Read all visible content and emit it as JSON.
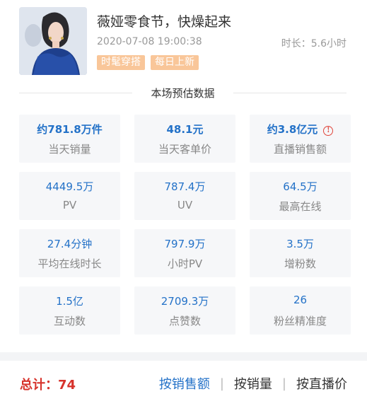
{
  "header": {
    "title": "薇娅零食节，快燥起来",
    "time": "2020-07-08 19:00:38",
    "duration_label": "时长：",
    "duration_value": "5.6小时",
    "tags": [
      "时髦穿搭",
      "每日上新"
    ]
  },
  "section_title": "本场预估数据",
  "stats": [
    {
      "value": "约781.8万件",
      "label": "当天销量",
      "bold": true
    },
    {
      "value": "48.1元",
      "label": "当天客单价",
      "bold": true
    },
    {
      "value": "约3.8亿元",
      "label": "直播销售额",
      "bold": true,
      "info_icon": "info-circle-icon"
    },
    {
      "value": "4449.5万",
      "label": "PV"
    },
    {
      "value": "787.4万",
      "label": "UV"
    },
    {
      "value": "64.5万",
      "label": "最高在线"
    },
    {
      "value": "27.4分钟",
      "label": "平均在线时长"
    },
    {
      "value": "797.9万",
      "label": "小时PV"
    },
    {
      "value": "3.5万",
      "label": "增粉数"
    },
    {
      "value": "1.5亿",
      "label": "互动数"
    },
    {
      "value": "2709.3万",
      "label": "点赞数"
    },
    {
      "value": "26",
      "label": "粉丝精准度"
    }
  ],
  "footer": {
    "total_label": "总计：",
    "total_value": "74",
    "sort_options": [
      "按销售额",
      "按销量",
      "按直播价"
    ],
    "active_sort": "按销售额"
  },
  "colors": {
    "accent": "#2472c8",
    "total": "#d7332c",
    "tag_bg": "#f9c699",
    "card_bg": "#f6f7f9"
  }
}
